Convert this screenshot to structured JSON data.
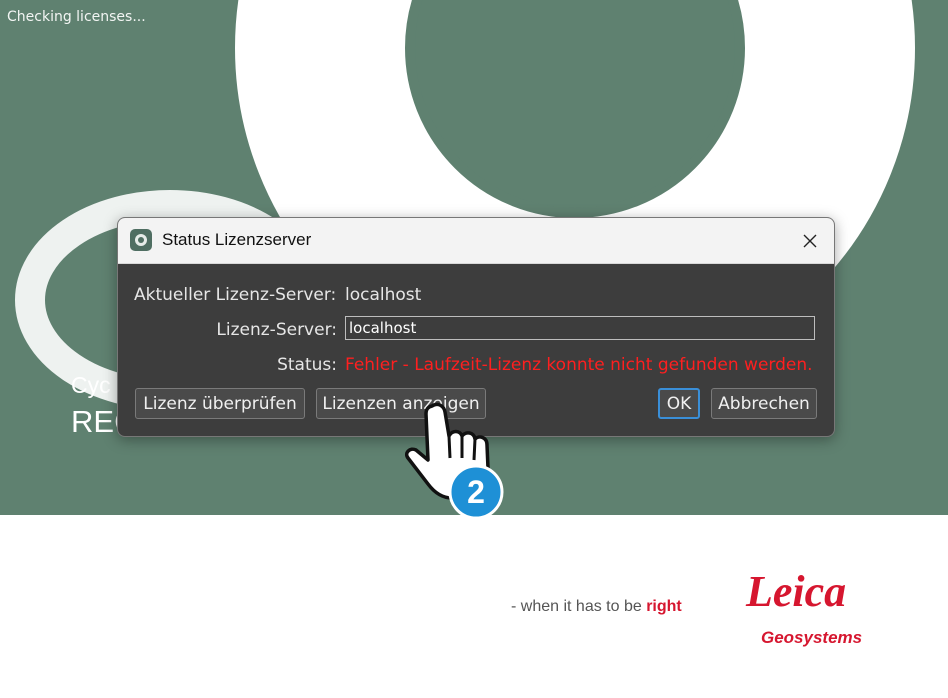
{
  "splash": {
    "loading_status": "Checking licenses...",
    "product_line1": "Cyc",
    "product_line2": "REC",
    "tagline_prefix": "- when it has to be ",
    "tagline_emphasis": "right",
    "brand_name": "Leica",
    "brand_sub": "Geosystems",
    "colors": {
      "background": "#5f8170",
      "brand_red": "#d6162f"
    }
  },
  "dialog": {
    "title": "Status Lizenzserver",
    "close_icon": "close-icon",
    "current_server_label": "Aktueller Lizenz-Server:",
    "current_server_value": "localhost",
    "server_label": "Lizenz-Server:",
    "server_input_value": "localhost",
    "status_label": "Status:",
    "status_value": "Fehler - Laufzeit-Lizenz konnte nicht gefunden werden.",
    "buttons": {
      "check": "Lizenz überprüfen",
      "show": "Lizenzen anzeigen",
      "ok": "OK",
      "cancel": "Abbrechen"
    }
  },
  "overlay": {
    "step_number": "2"
  }
}
